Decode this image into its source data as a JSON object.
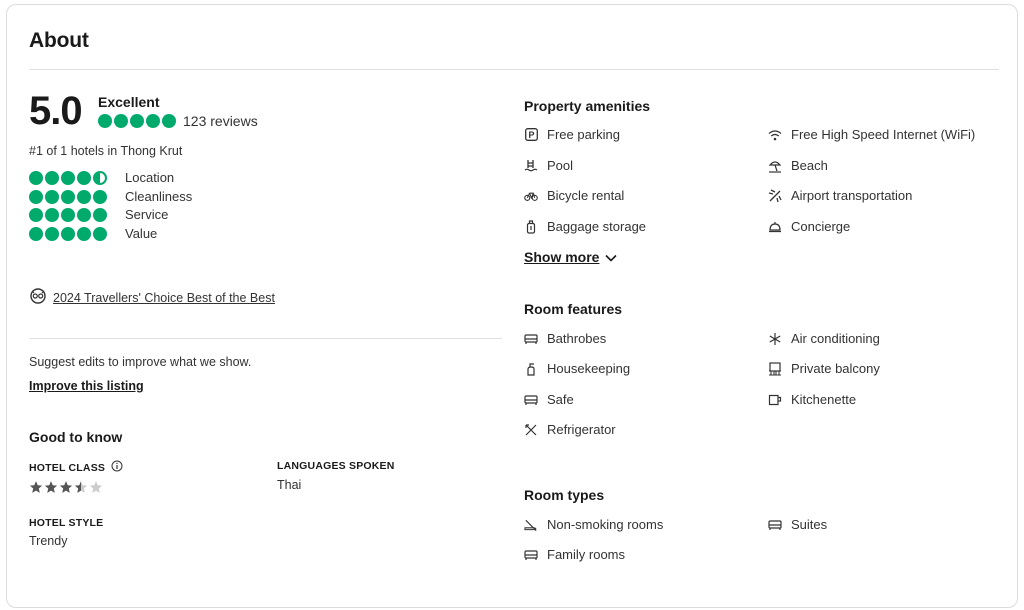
{
  "header": {
    "title": "About"
  },
  "rating": {
    "score": "5.0",
    "label": "Excellent",
    "bubbles": 5,
    "reviews": "123 reviews",
    "rank": "#1 of 1 hotels in Thong Krut",
    "categories": [
      {
        "label": "Location",
        "rating": 4.5
      },
      {
        "label": "Cleanliness",
        "rating": 5
      },
      {
        "label": "Service",
        "rating": 5
      },
      {
        "label": "Value",
        "rating": 5
      }
    ]
  },
  "award": {
    "label": "2024 Travellers' Choice Best of the Best",
    "icon": "award-badge-icon"
  },
  "suggest": {
    "text": "Suggest edits to improve what we show.",
    "link": "Improve this listing"
  },
  "good_to_know": {
    "title": "Good to know",
    "hotel_class_label": "HOTEL CLASS",
    "hotel_class_stars": 3.5,
    "hotel_class_max": 5,
    "languages_label": "LANGUAGES SPOKEN",
    "languages_value": "Thai",
    "hotel_style_label": "HOTEL STYLE",
    "hotel_style_value": "Trendy"
  },
  "property_amenities": {
    "title": "Property amenities",
    "items": [
      {
        "label": "Free parking",
        "icon": "parking-icon"
      },
      {
        "label": "Free High Speed Internet (WiFi)",
        "icon": "wifi-icon"
      },
      {
        "label": "Pool",
        "icon": "pool-icon"
      },
      {
        "label": "Beach",
        "icon": "beach-icon"
      },
      {
        "label": "Bicycle rental",
        "icon": "bicycle-icon"
      },
      {
        "label": "Airport transportation",
        "icon": "plane-icon"
      },
      {
        "label": "Baggage storage",
        "icon": "luggage-icon"
      },
      {
        "label": "Concierge",
        "icon": "concierge-bell-icon"
      }
    ],
    "show_more": "Show more"
  },
  "room_features": {
    "title": "Room features",
    "items": [
      {
        "label": "Bathrobes",
        "icon": "bed-icon"
      },
      {
        "label": "Air conditioning",
        "icon": "snowflake-icon"
      },
      {
        "label": "Housekeeping",
        "icon": "spray-bottle-icon"
      },
      {
        "label": "Private balcony",
        "icon": "balcony-icon"
      },
      {
        "label": "Safe",
        "icon": "bed-icon"
      },
      {
        "label": "Kitchenette",
        "icon": "mug-icon"
      },
      {
        "label": "Refrigerator",
        "icon": "utensils-icon"
      }
    ]
  },
  "room_types": {
    "title": "Room types",
    "items": [
      {
        "label": "Non-smoking rooms",
        "icon": "no-smoking-icon"
      },
      {
        "label": "Suites",
        "icon": "bed-icon"
      },
      {
        "label": "Family rooms",
        "icon": "bed-icon"
      }
    ]
  },
  "colors": {
    "bubble": "#00aa6c",
    "divider": "#e0e0e0",
    "star": "#555555"
  }
}
